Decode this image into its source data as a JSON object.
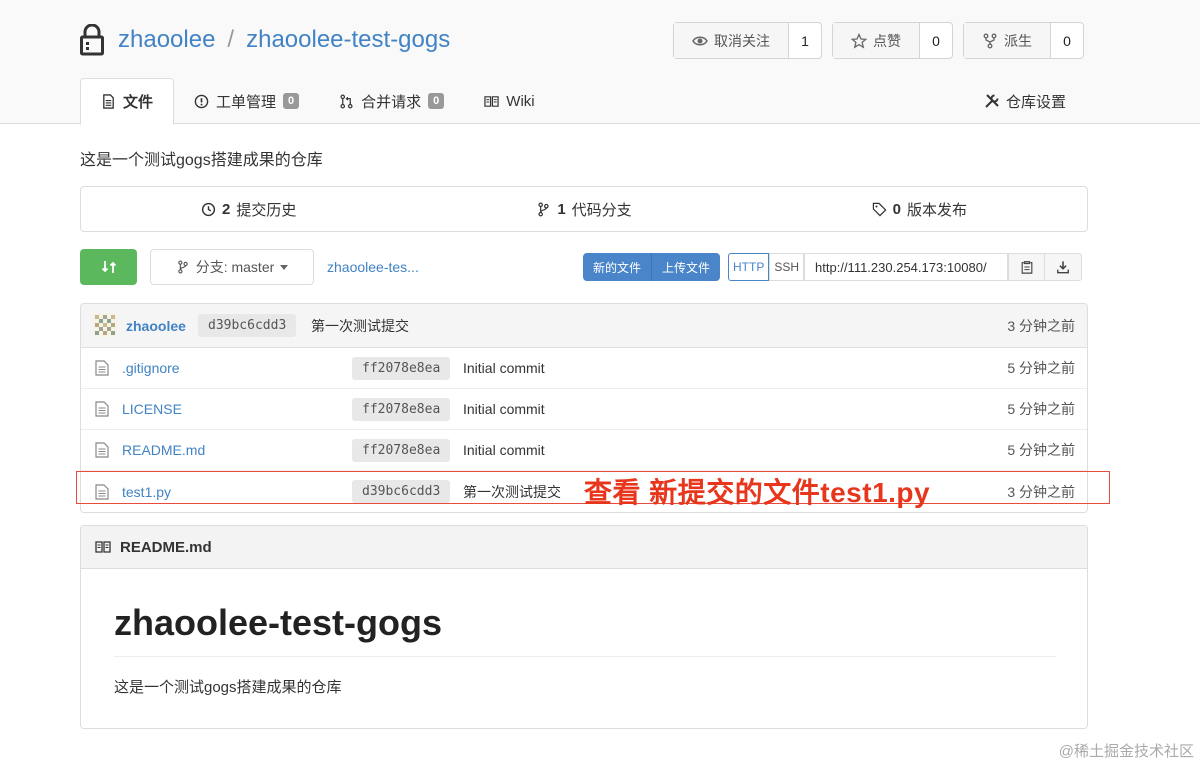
{
  "repo": {
    "owner": "zhaoolee",
    "separator": "/",
    "name": "zhaoolee-test-gogs"
  },
  "actions": [
    {
      "label": "取消关注",
      "count": "1",
      "icon": "eye-icon"
    },
    {
      "label": "点赞",
      "count": "0",
      "icon": "star-icon"
    },
    {
      "label": "派生",
      "count": "0",
      "icon": "fork-icon"
    }
  ],
  "tabs": {
    "files": "文件",
    "issues": "工单管理",
    "issues_count": "0",
    "pulls": "合并请求",
    "pulls_count": "0",
    "wiki": "Wiki",
    "settings": "仓库设置"
  },
  "description": "这是一个测试gogs搭建成果的仓库",
  "stats": {
    "commits_num": "2",
    "commits_label": "提交历史",
    "branches_num": "1",
    "branches_label": "代码分支",
    "releases_num": "0",
    "releases_label": "版本发布"
  },
  "toolbar": {
    "branch_label": "分支: master",
    "breadcrumb": "zhaoolee-tes...",
    "new_file": "新的文件",
    "upload_file": "上传文件",
    "http": "HTTP",
    "ssh": "SSH",
    "clone_url": "http://111.230.254.173:10080/"
  },
  "latest_commit": {
    "user": "zhaoolee",
    "sha": "d39bc6cdd3",
    "message": "第一次测试提交",
    "time": "3 分钟之前"
  },
  "files": [
    {
      "name": ".gitignore",
      "sha": "ff2078e8ea",
      "message": "Initial commit",
      "time": "5 分钟之前"
    },
    {
      "name": "LICENSE",
      "sha": "ff2078e8ea",
      "message": "Initial commit",
      "time": "5 分钟之前"
    },
    {
      "name": "README.md",
      "sha": "ff2078e8ea",
      "message": "Initial commit",
      "time": "5 分钟之前"
    },
    {
      "name": "test1.py",
      "sha": "d39bc6cdd3",
      "message": "第一次测试提交",
      "time": "3 分钟之前"
    }
  ],
  "annotation": "查看 新提交的文件test1.py",
  "readme": {
    "filename": "README.md",
    "heading": "zhaoolee-test-gogs",
    "body": "这是一个测试gogs搭建成果的仓库"
  },
  "watermark": "@稀土掘金技术社区",
  "colors": {
    "link": "#4183c4",
    "green": "#5cb85c",
    "blue": "#4a85c9",
    "annotation": "#e8361d"
  }
}
